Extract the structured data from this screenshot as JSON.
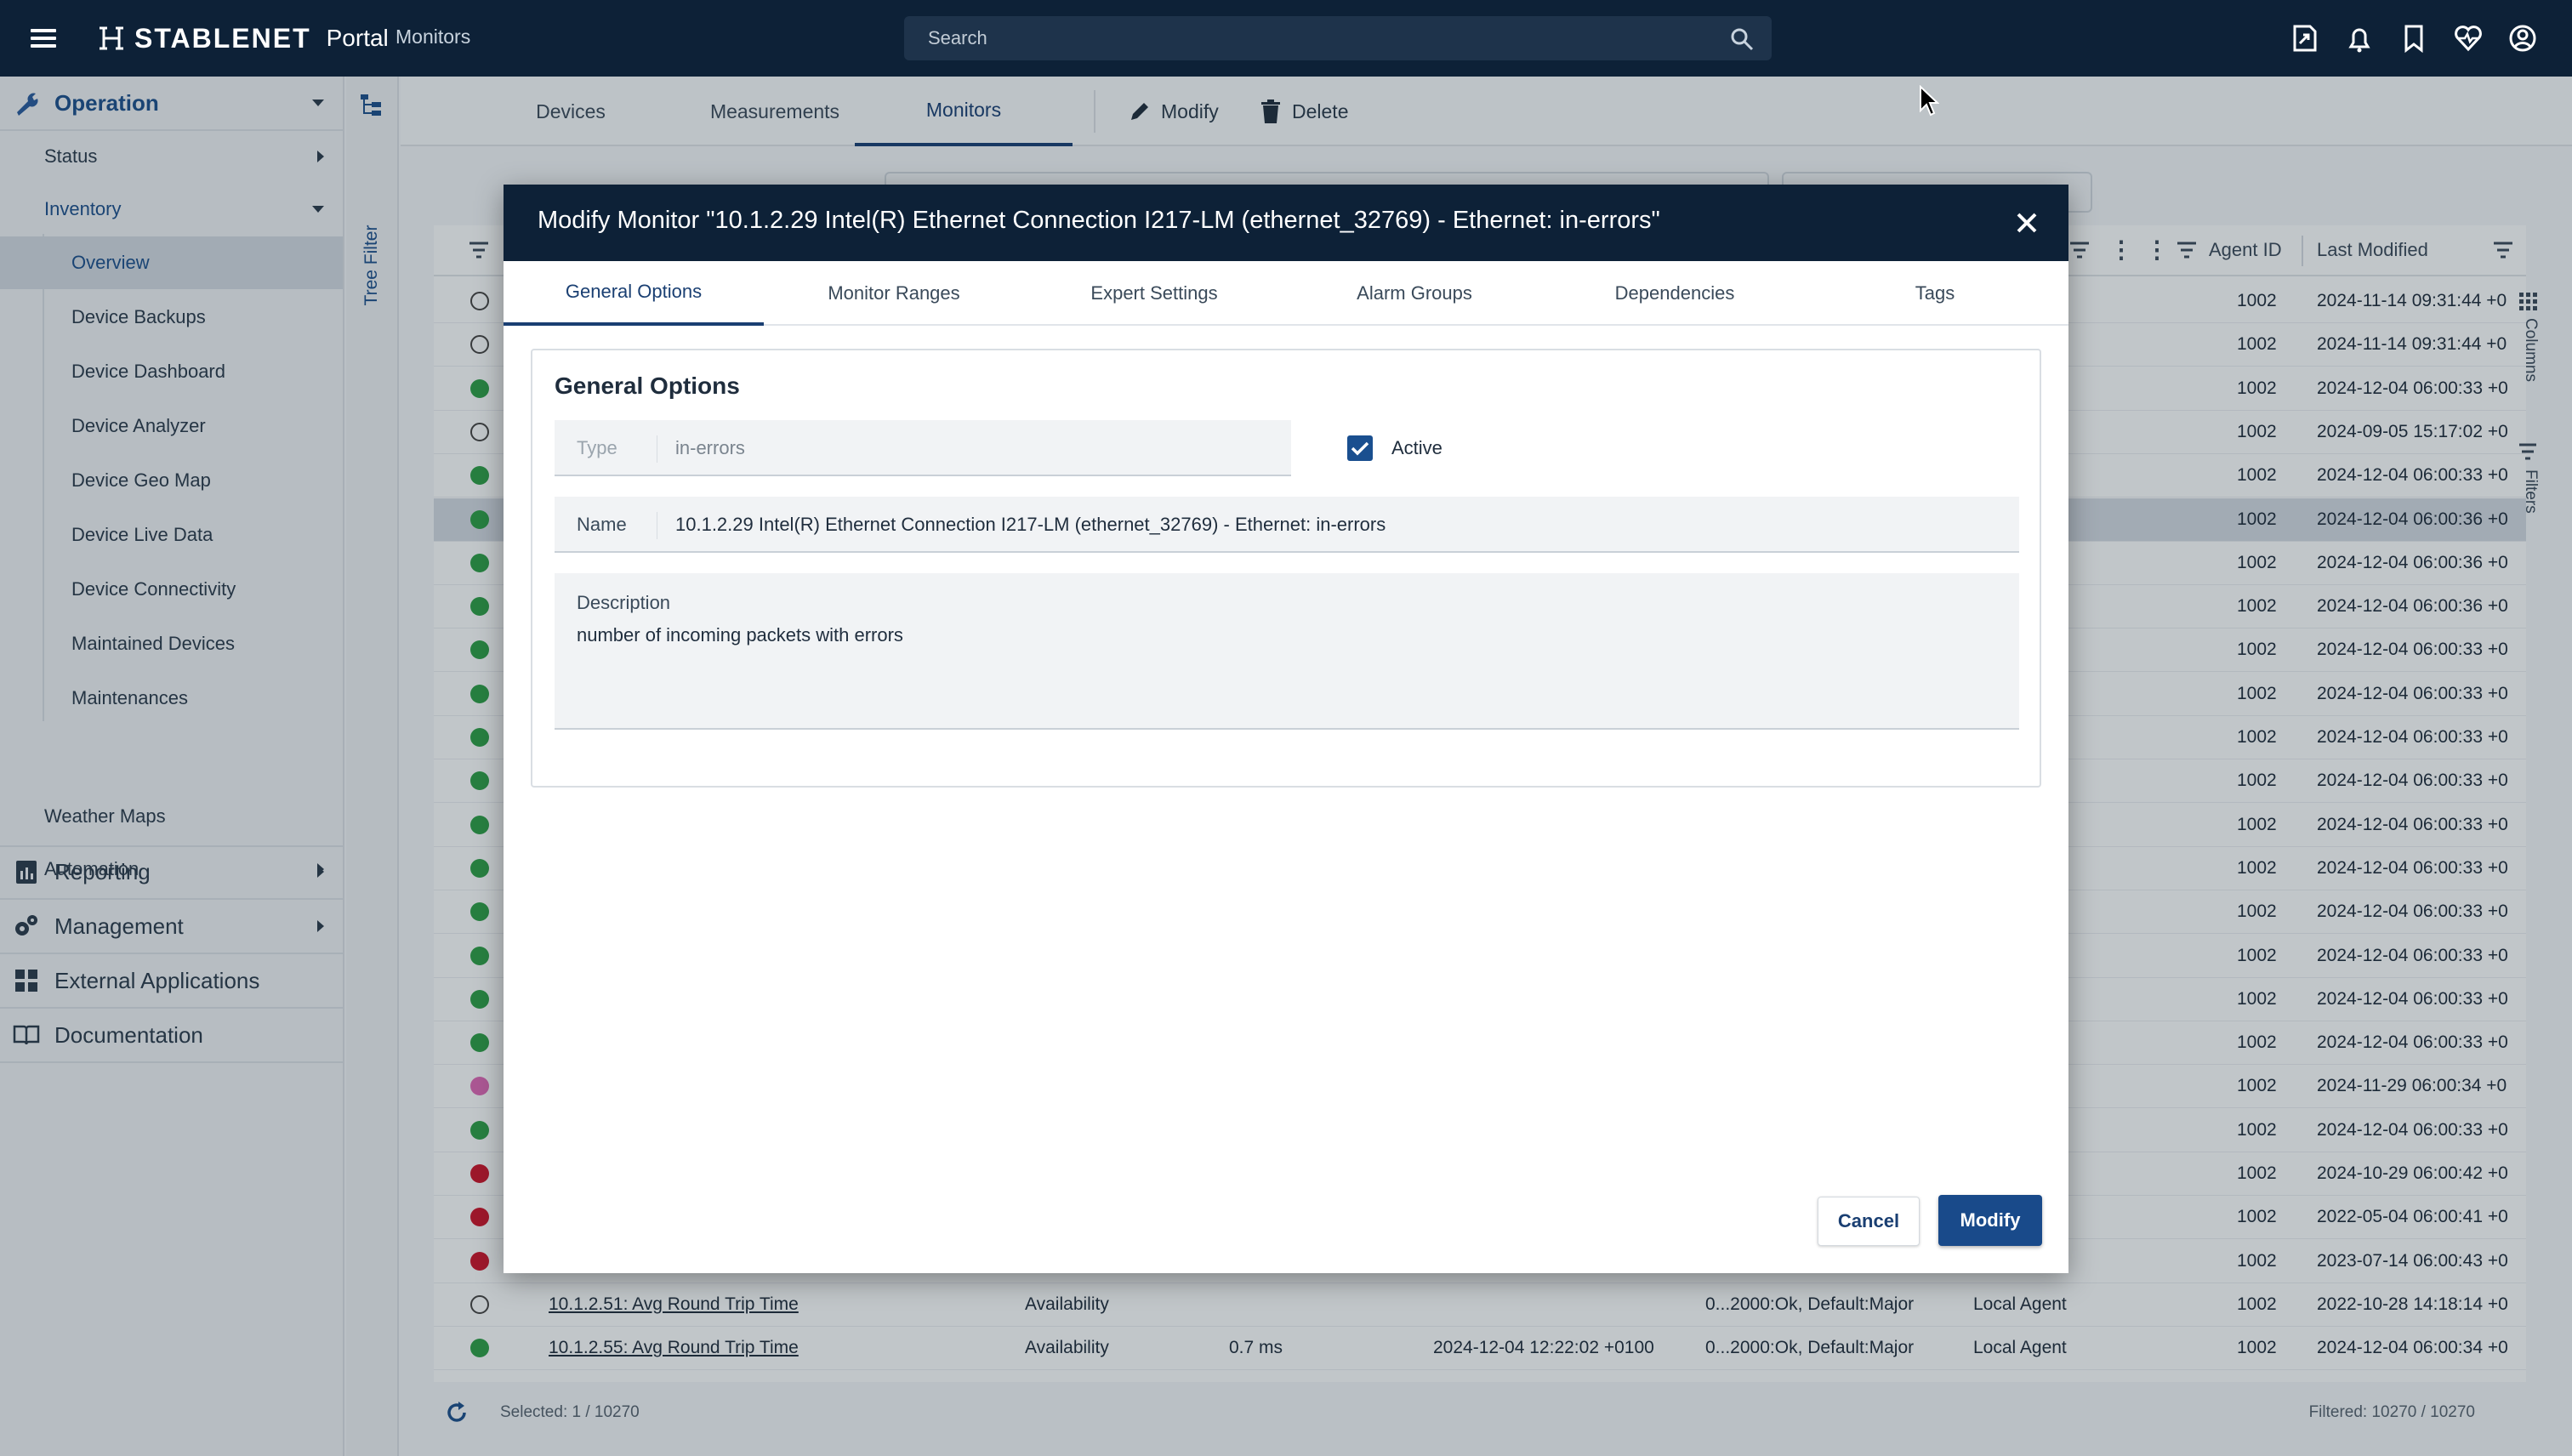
{
  "app": {
    "brand": "STABLENET",
    "brand_suffix": "Portal",
    "crumb": "Monitors"
  },
  "search": {
    "placeholder": "Search"
  },
  "colors": {
    "navy": "#0d2137",
    "accent": "#1a3f72",
    "ok": "#2e9a47",
    "critical": "#c4172c",
    "warning_pink": "#d667b1"
  },
  "nav": {
    "operation": "Operation",
    "status": "Status",
    "inventory": "Inventory",
    "inventory_items": [
      "Overview",
      "Device Backups",
      "Device Dashboard",
      "Device Analyzer",
      "Device Geo Map",
      "Device Live Data",
      "Device Connectivity",
      "Maintained Devices",
      "Maintenances"
    ],
    "weather_maps": "Weather Maps",
    "automation": "Automation",
    "reporting": "Reporting",
    "management": "Management",
    "external_apps": "External Applications",
    "documentation": "Documentation"
  },
  "tree_filter": "Tree Filter",
  "main_tabs": [
    "Devices",
    "Measurements",
    "Monitors"
  ],
  "toolbar": {
    "modify": "Modify",
    "delete": "Delete"
  },
  "grid": {
    "headers": {
      "agent_id": "Agent ID",
      "last_modified": "Last Modified"
    },
    "side_rail": {
      "columns": "Columns",
      "filters": "Filters"
    },
    "rows": [
      {
        "status": "empty",
        "agent": "1002",
        "modified": "2024-11-14 09:31:44 +0"
      },
      {
        "status": "empty",
        "agent": "1002",
        "modified": "2024-11-14 09:31:44 +0"
      },
      {
        "status": "green",
        "agent": "1002",
        "modified": "2024-12-04 06:00:33 +0"
      },
      {
        "status": "empty",
        "agent": "1002",
        "modified": "2024-09-05 15:17:02 +0"
      },
      {
        "status": "green",
        "agent": "1002",
        "modified": "2024-12-04 06:00:33 +0"
      },
      {
        "status": "green",
        "agent": "1002",
        "modified": "2024-12-04 06:00:36 +0"
      },
      {
        "status": "green",
        "agent": "1002",
        "modified": "2024-12-04 06:00:36 +0"
      },
      {
        "status": "green",
        "agent": "1002",
        "modified": "2024-12-04 06:00:36 +0"
      },
      {
        "status": "green",
        "agent": "1002",
        "modified": "2024-12-04 06:00:33 +0"
      },
      {
        "status": "green",
        "agent": "1002",
        "modified": "2024-12-04 06:00:33 +0"
      },
      {
        "status": "green",
        "agent": "1002",
        "modified": "2024-12-04 06:00:33 +0"
      },
      {
        "status": "green",
        "agent": "1002",
        "modified": "2024-12-04 06:00:33 +0"
      },
      {
        "status": "green",
        "agent": "1002",
        "modified": "2024-12-04 06:00:33 +0"
      },
      {
        "status": "green",
        "agent": "1002",
        "modified": "2024-12-04 06:00:33 +0"
      },
      {
        "status": "green",
        "agent": "1002",
        "modified": "2024-12-04 06:00:33 +0"
      },
      {
        "status": "green",
        "agent": "1002",
        "modified": "2024-12-04 06:00:33 +0"
      },
      {
        "status": "green",
        "agent": "1002",
        "modified": "2024-12-04 06:00:33 +0"
      },
      {
        "status": "green",
        "agent": "1002",
        "modified": "2024-12-04 06:00:33 +0"
      },
      {
        "status": "pink",
        "agent": "1002",
        "modified": "2024-11-29 06:00:34 +0"
      },
      {
        "status": "green",
        "agent": "1002",
        "modified": "2024-12-04 06:00:33 +0"
      },
      {
        "status": "red",
        "agent": "1002",
        "modified": "2024-10-29 06:00:42 +0"
      },
      {
        "status": "red",
        "agent": "1002",
        "modified": "2022-05-04 06:00:41 +0"
      },
      {
        "status": "red",
        "agent": "1002",
        "modified": "2023-07-14 06:00:43 +0"
      },
      {
        "status": "empty",
        "name": "10.1.2.51: Avg Round Trip Time",
        "type": "Availability",
        "value": "",
        "time": "",
        "ranges": "0...2000:Ok, Default:Major",
        "agent_name": "Local Agent",
        "agent": "1002",
        "modified": "2022-10-28 14:18:14 +0"
      },
      {
        "status": "green",
        "name": "10.1.2.55: Avg Round Trip Time",
        "type": "Availability",
        "value": "0.7 ms",
        "time": "2024-12-04 12:22:02 +0100",
        "ranges": "0...2000:Ok, Default:Major",
        "agent_name": "Local Agent",
        "agent": "1002",
        "modified": "2024-12-04 06:00:34 +0"
      }
    ]
  },
  "status_bar": {
    "selected": "Selected: 1 / 10270",
    "filtered": "Filtered: 10270 / 10270"
  },
  "dialog": {
    "title": "Modify Monitor \"10.1.2.29 Intel(R) Ethernet Connection I217-LM (ethernet_32769) - Ethernet: in-errors\"",
    "tabs": [
      "General Options",
      "Monitor Ranges",
      "Expert Settings",
      "Alarm Groups",
      "Dependencies",
      "Tags"
    ],
    "section_title": "General Options",
    "type_label": "Type",
    "type_value": "in-errors",
    "active_label": "Active",
    "active_checked": true,
    "name_label": "Name",
    "name_value": "10.1.2.29 Intel(R) Ethernet Connection I217-LM (ethernet_32769) - Ethernet: in-errors",
    "description_label": "Description",
    "description_value": "number of incoming packets with errors",
    "cancel": "Cancel",
    "modify": "Modify"
  }
}
